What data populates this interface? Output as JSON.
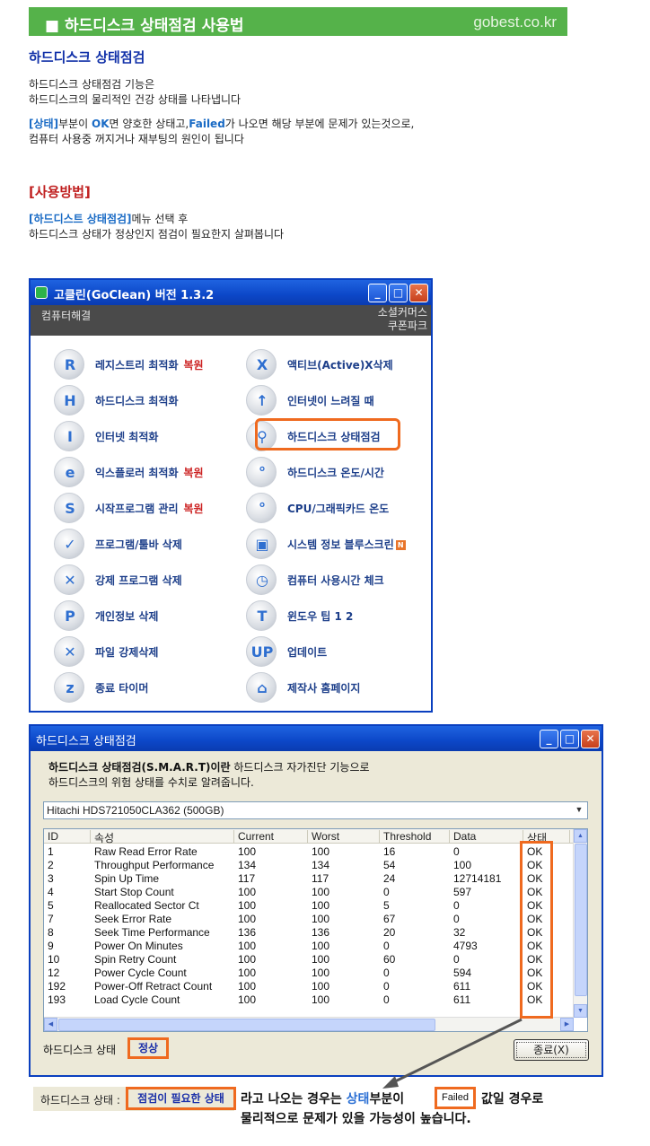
{
  "banner": {
    "title": "■ 하드디스크 상태점검 사용법",
    "site": "gobest.co.kr"
  },
  "intro": {
    "heading": "하드디스크 상태점검",
    "line1": "하드디스크 상태점검 기능은",
    "line2": "하드디스크의 물리적인 건강 상태를 나타냅니다",
    "line3_a": "[상태]",
    "line3_b": "부분이 ",
    "line3_c": "OK",
    "line3_d": "면 양호한 상태고,",
    "line3_e": "Failed",
    "line3_f": "가 나오면 해당 부분에 문제가 있는것으로,",
    "line4": "컴퓨터 사용중 꺼지거나 재부팅의 원인이 됩니다"
  },
  "usage": {
    "heading": "[사용방법]",
    "line1_a": "[하드디스트 상태점검]",
    "line1_b": "메뉴 선택 후",
    "line2": "하드디스크 상태가 정상인지 점검이 필요한지 살펴봅니다"
  },
  "goclean": {
    "title": "고클린(GoClean) 버전 1.3.2",
    "menu_left": "컴퓨터해결",
    "menu_right1": "소셜커머스",
    "menu_right2": "쿠폰파크",
    "restore": "복원",
    "left_items": [
      {
        "label": "레지스트리 최적화",
        "icon": "R",
        "restore": true
      },
      {
        "label": "하드디스크 최적화",
        "icon": "H",
        "restore": false
      },
      {
        "label": "인터넷 최적화",
        "icon": "I",
        "restore": false
      },
      {
        "label": "익스플로러 최적화",
        "icon": "e",
        "restore": true
      },
      {
        "label": "시작프로그램 관리",
        "icon": "S",
        "restore": true
      },
      {
        "label": "프로그램/툴바 삭제",
        "icon": "✓",
        "restore": false
      },
      {
        "label": "강제 프로그램 삭제",
        "icon": "✕",
        "restore": false
      },
      {
        "label": "개인정보 삭제",
        "icon": "P",
        "restore": false
      },
      {
        "label": "파일 강제삭제",
        "icon": "✕",
        "restore": false
      },
      {
        "label": "종료 타이머",
        "icon": "z",
        "restore": false
      }
    ],
    "right_items": [
      {
        "label": "액티브(Active)X삭제",
        "icon": "X"
      },
      {
        "label": "인터넷이 느려질 때",
        "icon": "↑"
      },
      {
        "label": "하드디스크 상태점검",
        "icon": "⚲"
      },
      {
        "label": "하드디스크 온도/시간",
        "icon": "°"
      },
      {
        "label": "CPU/그래픽카드 온도",
        "icon": "°"
      },
      {
        "label": "시스템 정보 블루스크린",
        "icon": "▣",
        "badge": "N"
      },
      {
        "label": "컴퓨터 사용시간 체크",
        "icon": "◷"
      },
      {
        "label": "윈도우 팁 1  2",
        "icon": "T"
      },
      {
        "label": "업데이트",
        "icon": "UP"
      },
      {
        "label": "제작사 홈페이지",
        "icon": "⌂"
      }
    ]
  },
  "smart": {
    "title": "하드디스크 상태점검",
    "desc1_bold": "하드디스크 상태점검(S.M.A.R.T)이란",
    "desc1_rest": " 하드디스크 자가진단 기능으로",
    "desc2": "하드디스크의 위험 상태를 수치로 알려줍니다.",
    "drive": "Hitachi HDS721050CLA362 (500GB)",
    "columns": [
      "ID",
      "속성",
      "Current",
      "Worst",
      "Threshold",
      "Data",
      "상태"
    ],
    "rows": [
      [
        "1",
        "Raw Read Error Rate",
        "100",
        "100",
        "16",
        "0",
        "OK"
      ],
      [
        "2",
        "Throughput Performance",
        "134",
        "134",
        "54",
        "100",
        "OK"
      ],
      [
        "3",
        "Spin Up Time",
        "117",
        "117",
        "24",
        "12714181",
        "OK"
      ],
      [
        "4",
        "Start Stop Count",
        "100",
        "100",
        "0",
        "597",
        "OK"
      ],
      [
        "5",
        "Reallocated Sector Ct",
        "100",
        "100",
        "5",
        "0",
        "OK"
      ],
      [
        "7",
        "Seek Error Rate",
        "100",
        "100",
        "67",
        "0",
        "OK"
      ],
      [
        "8",
        "Seek Time Performance",
        "136",
        "136",
        "20",
        "32",
        "OK"
      ],
      [
        "9",
        "Power On Minutes",
        "100",
        "100",
        "0",
        "4793",
        "OK"
      ],
      [
        "10",
        "Spin Retry Count",
        "100",
        "100",
        "60",
        "0",
        "OK"
      ],
      [
        "12",
        "Power Cycle Count",
        "100",
        "100",
        "0",
        "594",
        "OK"
      ],
      [
        "192",
        "Power-Off Retract Count",
        "100",
        "100",
        "0",
        "611",
        "OK"
      ],
      [
        "193",
        "Load Cycle Count",
        "100",
        "100",
        "0",
        "611",
        "OK"
      ]
    ],
    "status_label": "하드디스크 상태",
    "status_value": "정상",
    "close": "종료(X)"
  },
  "bottom": {
    "label": "하드디스크 상태 :",
    "value": "점검이 필요한 상태",
    "note_a": "라고 나오는 경우는 ",
    "note_b": "상태",
    "note_c": "부분이",
    "failed": "Failed",
    "note_d": "값일 경우로",
    "note_e": "물리적으로 문제가 있을 가능성이 높습니다."
  }
}
